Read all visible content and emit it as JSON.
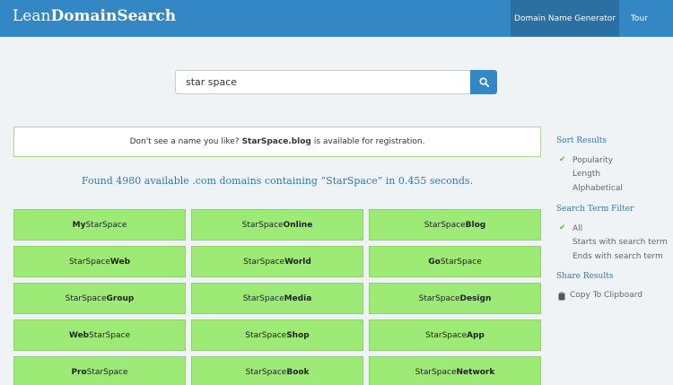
{
  "header": {
    "brand_light": "Lean",
    "brand_bold": "DomainSearch",
    "nav": {
      "generator": "Domain Name Generator",
      "tour": "Tour"
    }
  },
  "search": {
    "value": "star space",
    "button_icon": "search-icon"
  },
  "notice": {
    "prefix": "Don't see a name you like?",
    "domain": "StarSpace.blog",
    "suffix": "is available for registration."
  },
  "results_summary": "Found 4980 available .com domains containing “StarSpace” in 0.455 seconds.",
  "results": [
    {
      "prefix": "My",
      "prefix_bold": true,
      "suffix": "StarSpace",
      "suffix_bold": false
    },
    {
      "prefix": "StarSpace",
      "prefix_bold": false,
      "suffix": "Online",
      "suffix_bold": true
    },
    {
      "prefix": "StarSpace",
      "prefix_bold": false,
      "suffix": "Blog",
      "suffix_bold": true
    },
    {
      "prefix": "StarSpace",
      "prefix_bold": false,
      "suffix": "Web",
      "suffix_bold": true
    },
    {
      "prefix": "StarSpace",
      "prefix_bold": false,
      "suffix": "World",
      "suffix_bold": true
    },
    {
      "prefix": "Go",
      "prefix_bold": true,
      "suffix": "StarSpace",
      "suffix_bold": false
    },
    {
      "prefix": "StarSpace",
      "prefix_bold": false,
      "suffix": "Group",
      "suffix_bold": true
    },
    {
      "prefix": "StarSpace",
      "prefix_bold": false,
      "suffix": "Media",
      "suffix_bold": true
    },
    {
      "prefix": "StarSpace",
      "prefix_bold": false,
      "suffix": "Design",
      "suffix_bold": true
    },
    {
      "prefix": "Web",
      "prefix_bold": true,
      "suffix": "StarSpace",
      "suffix_bold": false
    },
    {
      "prefix": "StarSpace",
      "prefix_bold": false,
      "suffix": "Shop",
      "suffix_bold": true
    },
    {
      "prefix": "StarSpace",
      "prefix_bold": false,
      "suffix": "App",
      "suffix_bold": true
    },
    {
      "prefix": "Pro",
      "prefix_bold": true,
      "suffix": "StarSpace",
      "suffix_bold": false
    },
    {
      "prefix": "StarSpace",
      "prefix_bold": false,
      "suffix": "Book",
      "suffix_bold": true
    },
    {
      "prefix": "StarSpace",
      "prefix_bold": false,
      "suffix": "Network",
      "suffix_bold": true
    }
  ],
  "sidebar": {
    "sort": {
      "title": "Sort Results",
      "options": [
        "Popularity",
        "Length",
        "Alphabetical"
      ],
      "selected": "Popularity"
    },
    "filter": {
      "title": "Search Term Filter",
      "options": [
        "All",
        "Starts with search term",
        "Ends with search term"
      ],
      "selected": "All"
    },
    "share": {
      "title": "Share Results",
      "copy_label": "Copy To Clipboard",
      "copy_icon": "clipboard-icon"
    }
  },
  "colors": {
    "header_bg": "#3387c4",
    "nav_active_bg": "#2a70a3",
    "result_bg": "#9dea76",
    "accent_text": "#2f79b0",
    "check": "#5bbf3a"
  }
}
